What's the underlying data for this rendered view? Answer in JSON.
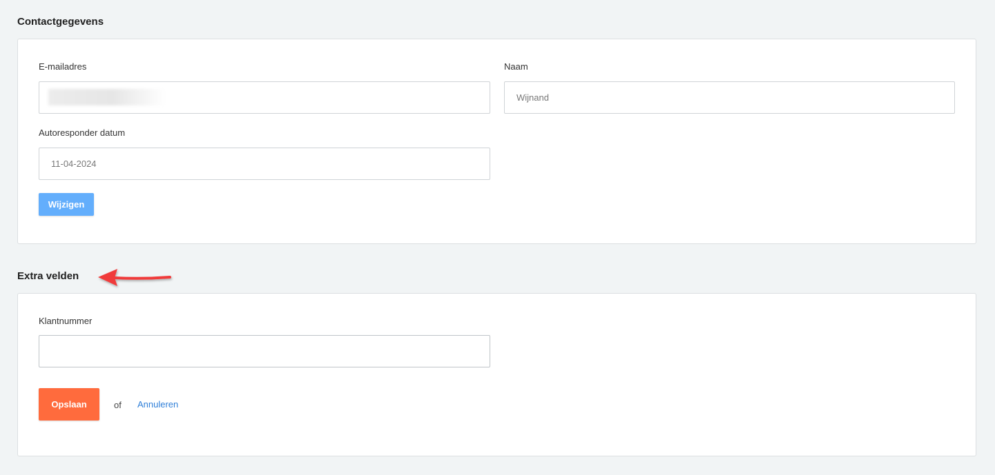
{
  "contact": {
    "title": "Contactgegevens",
    "email_label": "E-mailadres",
    "name_label": "Naam",
    "name_value": "Wijnand",
    "autoresponder_label": "Autoresponder datum",
    "autoresponder_value": "11-04-2024",
    "change_button": "Wijzigen"
  },
  "extra": {
    "title": "Extra velden",
    "customer_number_label": "Klantnummer",
    "customer_number_value": "",
    "save_button": "Opslaan",
    "or_text": "of",
    "cancel_link": "Annuleren"
  },
  "colors": {
    "save_accent": "#ff6b3d",
    "change_accent": "#63aefc",
    "link": "#2f7fd8",
    "annotation_arrow": "#f03a3a"
  },
  "icons": {
    "annotation": "red-arrow-left-icon"
  }
}
